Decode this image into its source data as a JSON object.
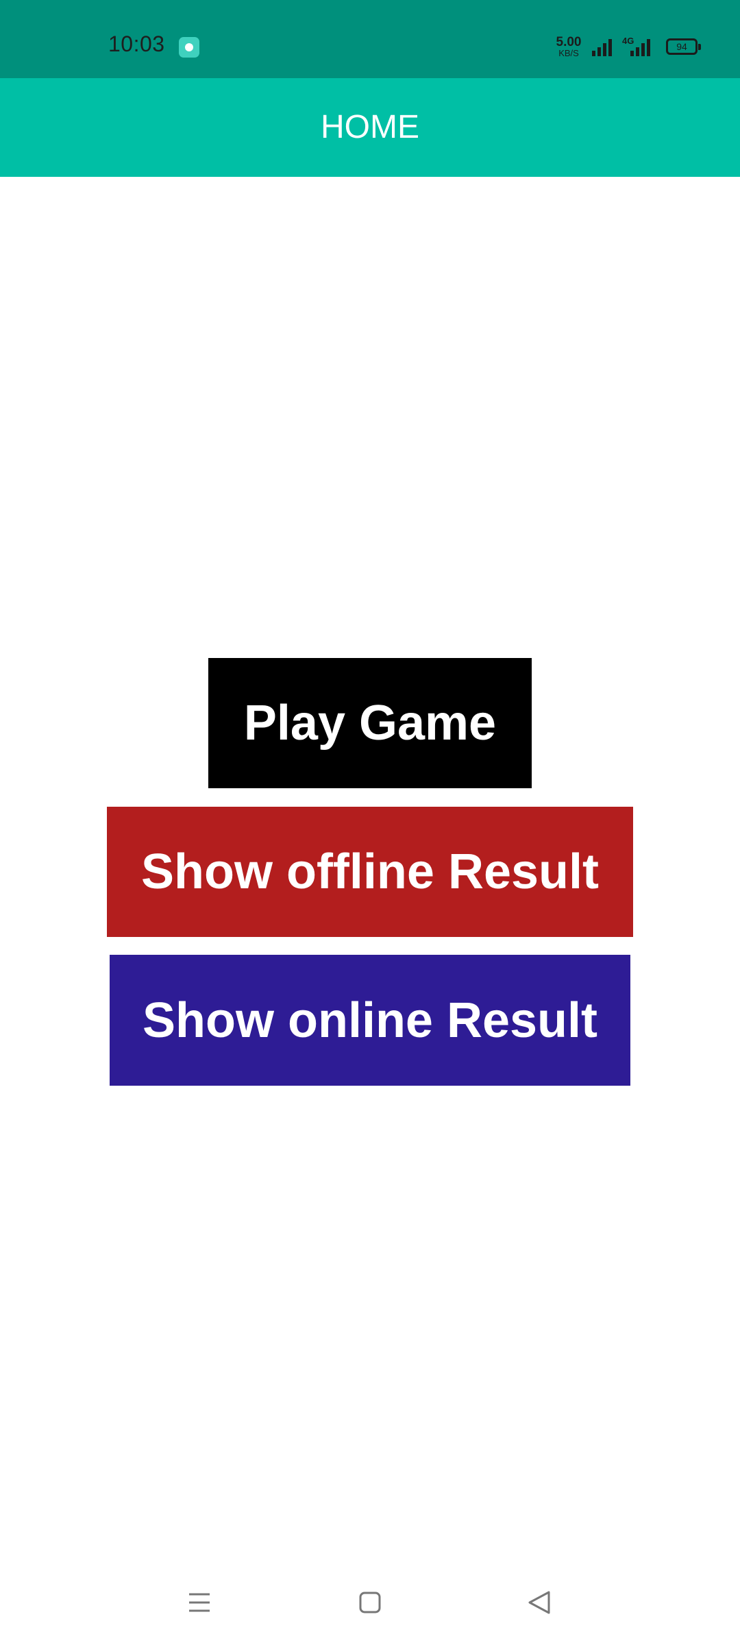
{
  "status_bar": {
    "time": "10:03",
    "net_speed_value": "5.00",
    "net_speed_unit": "KB/S",
    "network_type": "4G",
    "battery_level": "94",
    "icons": [
      "app-notification-icon",
      "signal-icon",
      "signal-4g-icon",
      "battery-icon"
    ]
  },
  "app_bar": {
    "title": "HOME"
  },
  "buttons": {
    "play_label": "Play Game",
    "offline_label": "Show offline Result",
    "online_label": "Show online Result"
  },
  "nav_bar": {
    "icons": [
      "menu-icon",
      "home-icon",
      "back-icon"
    ]
  },
  "colors": {
    "status_bar": "#00907c",
    "app_bar": "#00bfa5",
    "play_button": "#000000",
    "offline_button": "#b31e1e",
    "online_button": "#2e1c95"
  }
}
